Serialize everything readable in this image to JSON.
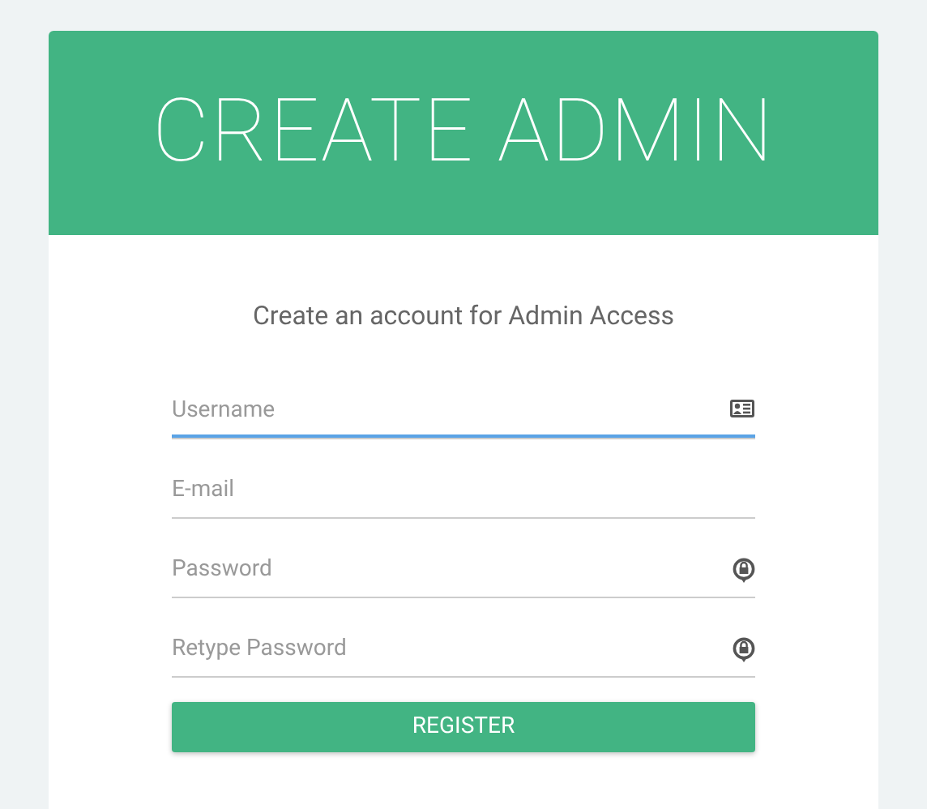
{
  "header": {
    "title": "CREATE ADMIN"
  },
  "subtitle": "Create an account for Admin Access",
  "fields": [
    {
      "placeholder": "Username",
      "kind": "username",
      "focused": true
    },
    {
      "placeholder": "E-mail",
      "kind": "email",
      "focused": false
    },
    {
      "placeholder": "Password",
      "kind": "password",
      "focused": false
    },
    {
      "placeholder": "Retype Password",
      "kind": "password",
      "focused": false
    }
  ],
  "button": "REGISTER"
}
